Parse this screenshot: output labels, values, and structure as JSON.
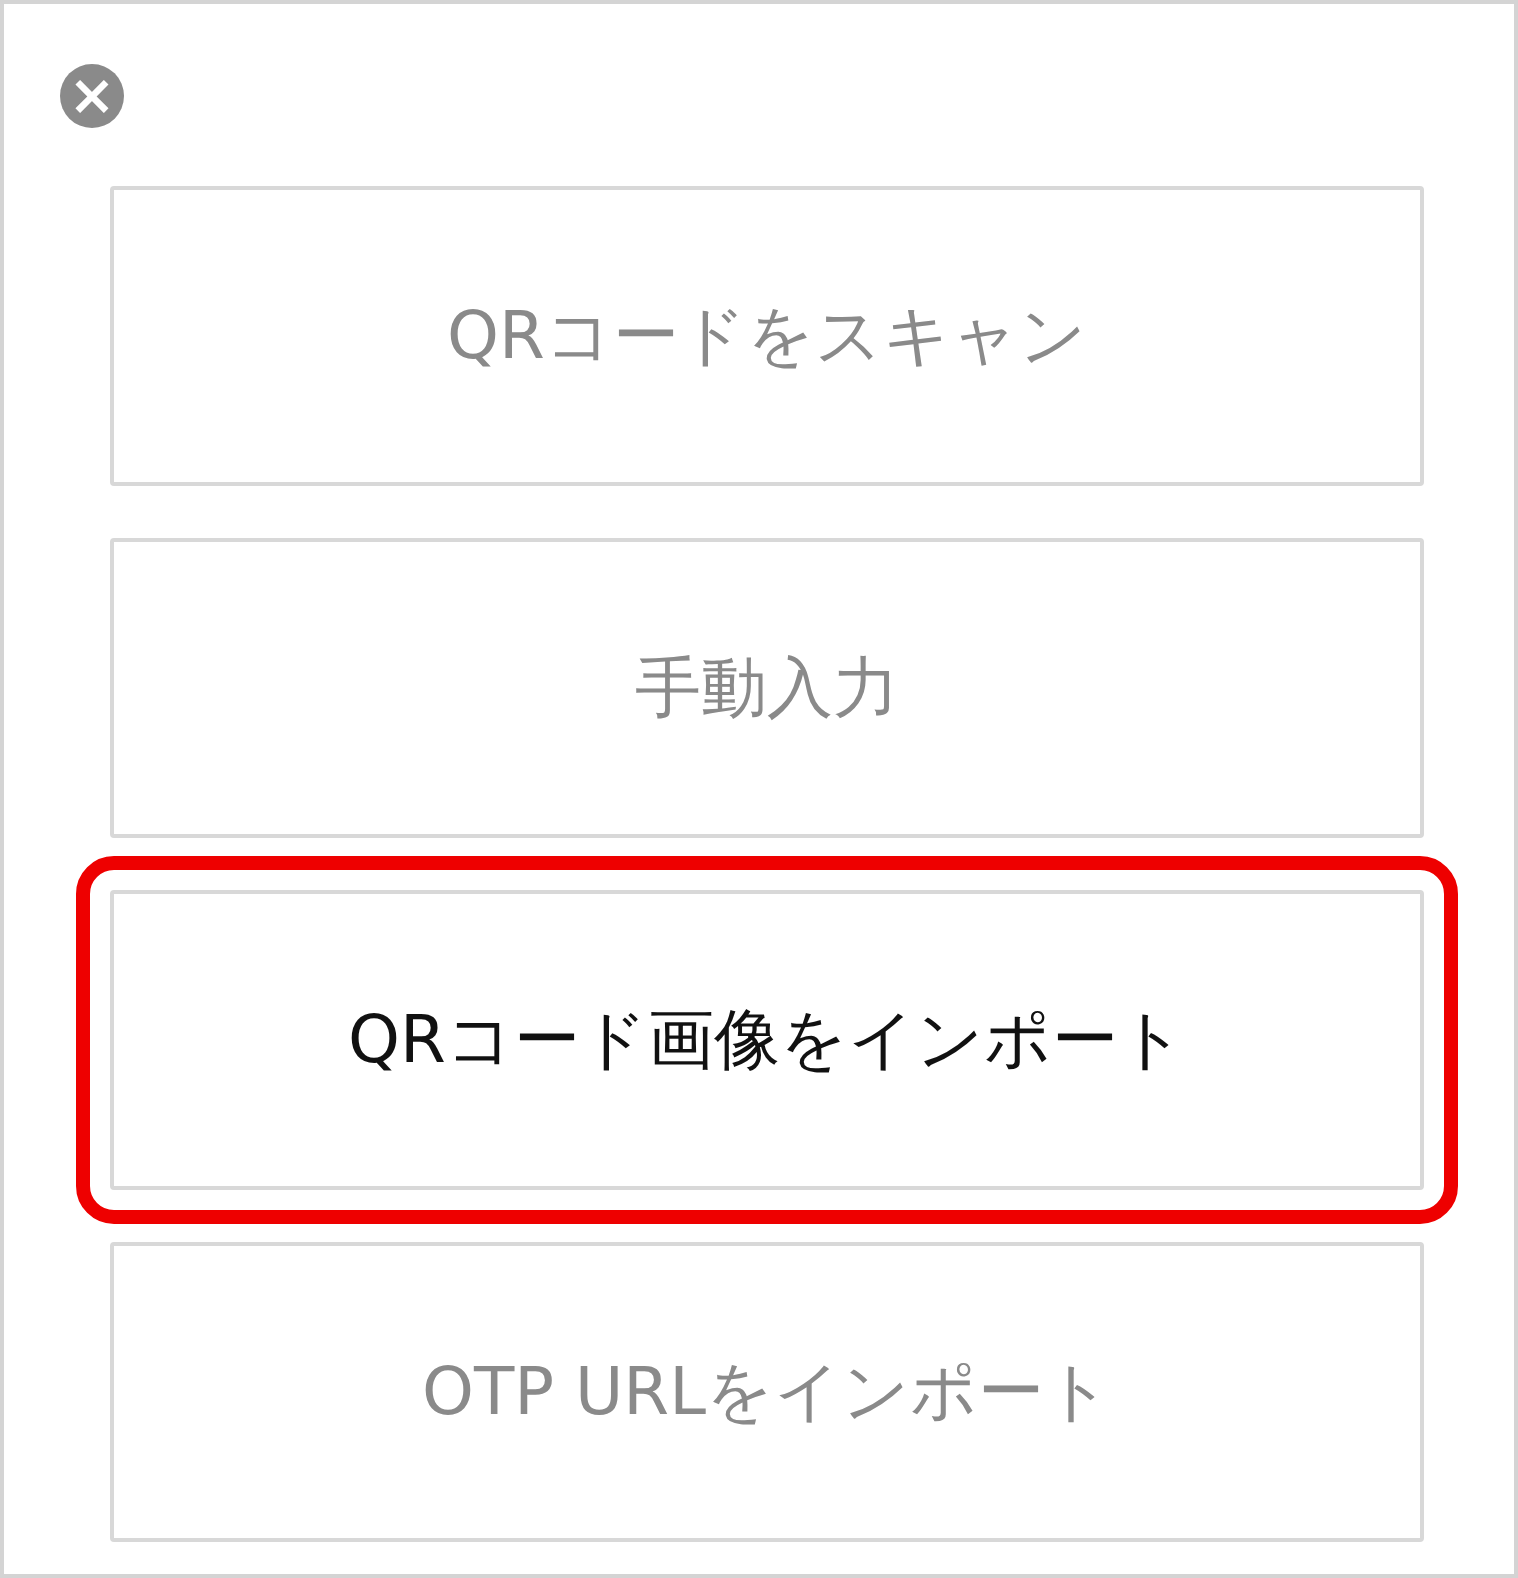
{
  "close_button": {
    "label": "×"
  },
  "buttons": [
    {
      "label": "QRコードをスキャン",
      "highlighted": false
    },
    {
      "label": "手動入力",
      "highlighted": false
    },
    {
      "label": "QRコード画像をインポート",
      "highlighted": true
    },
    {
      "label": "OTP URLをインポート",
      "highlighted": false
    }
  ]
}
